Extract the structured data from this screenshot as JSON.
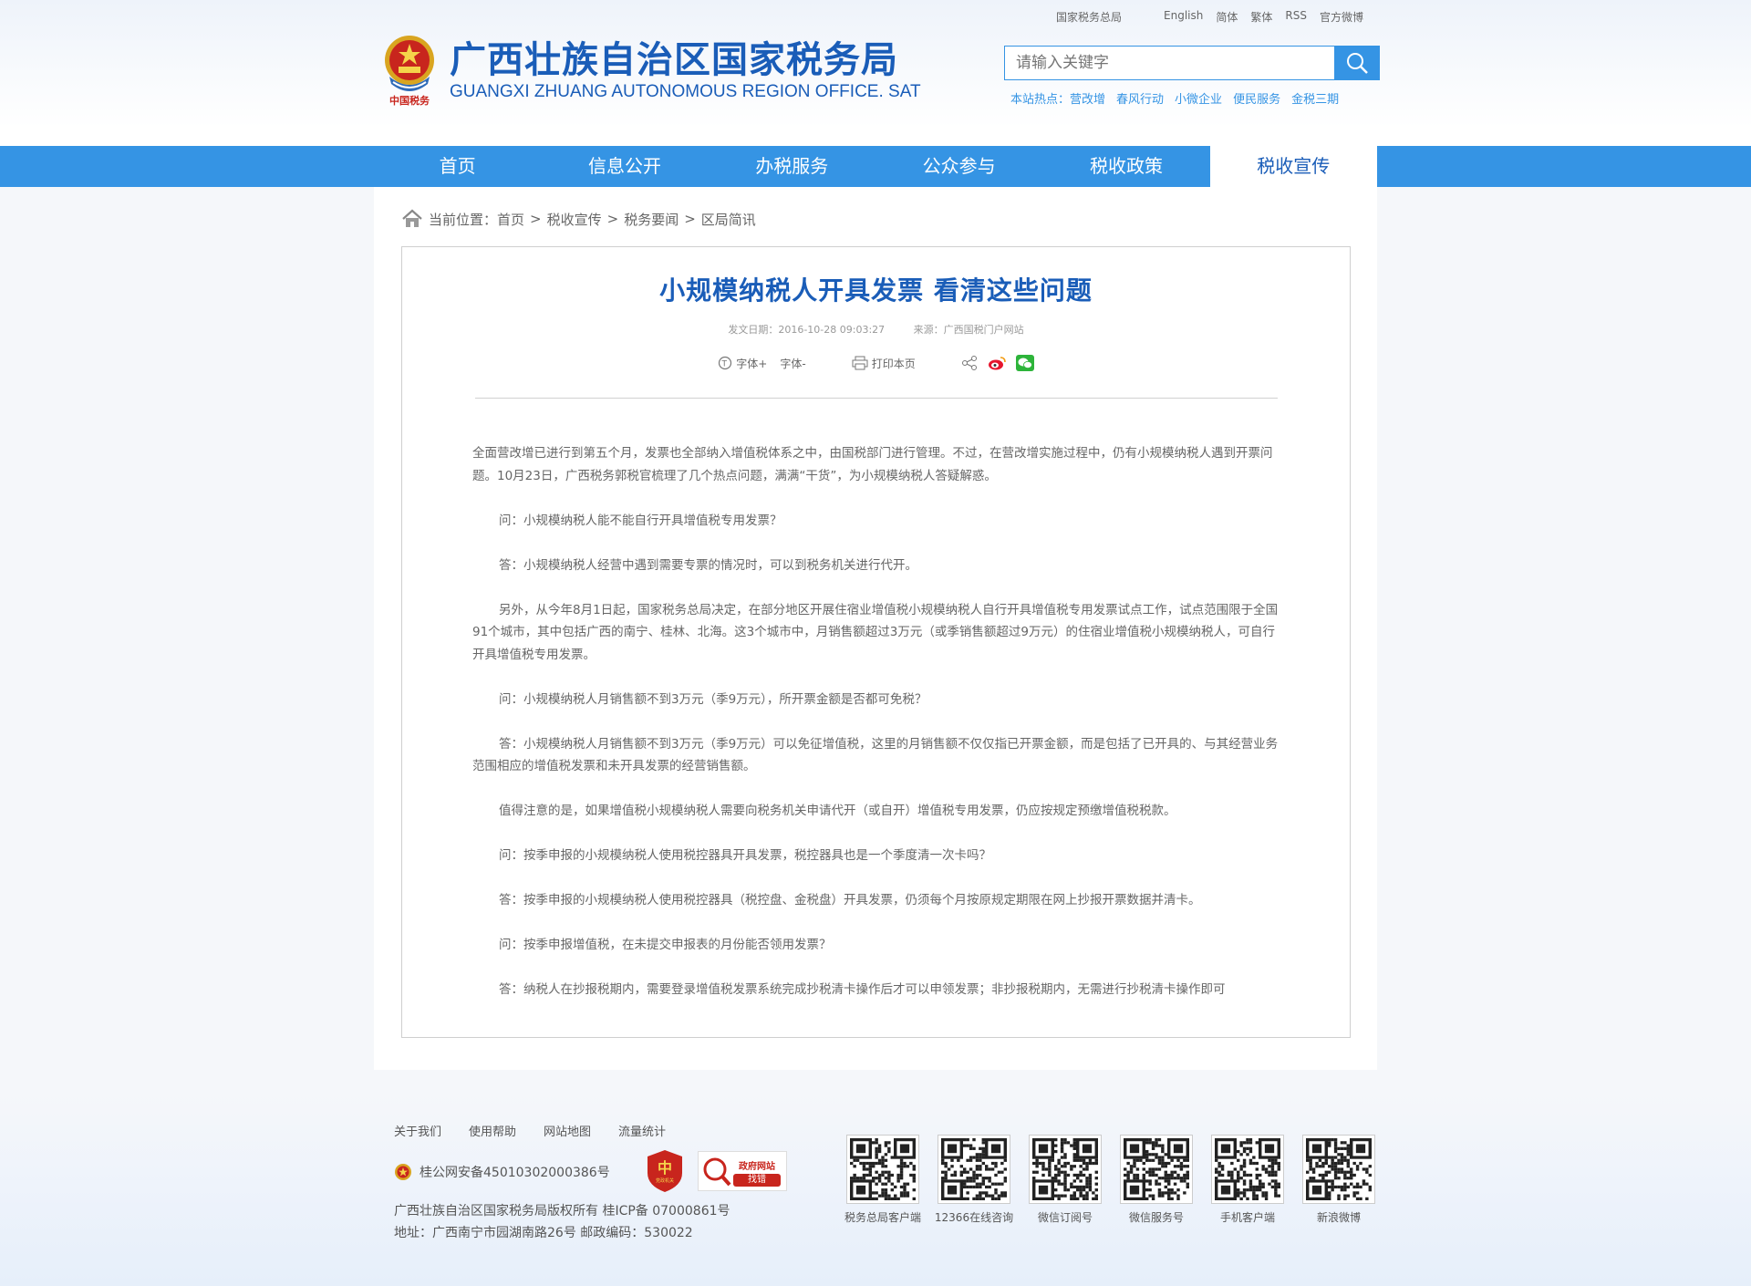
{
  "top_links": [
    "国家税务总局",
    "English",
    "简体",
    "繁体",
    "RSS",
    "官方微博"
  ],
  "logo": {
    "cn": "广西壮族自治区国家税务局",
    "en": "GUANGXI ZHUANG AUTONOMOUS REGION OFFICE. SAT",
    "seal_text": "中国税务"
  },
  "search": {
    "placeholder": "请输入关键字"
  },
  "hot": {
    "label": "本站热点：",
    "items": [
      "营改增",
      "春风行动",
      "小微企业",
      "便民服务",
      "金税三期"
    ]
  },
  "nav": {
    "items": [
      "首页",
      "信息公开",
      "办税服务",
      "公众参与",
      "税收政策",
      "税收宣传"
    ],
    "active": 5
  },
  "breadcrumb": {
    "label": "当前位置：",
    "items": [
      "首页",
      "税收宣传",
      "税务要闻",
      "区局简讯"
    ]
  },
  "article": {
    "title": "小规模纳税人开具发票 看清这些问题",
    "date": "发文日期：2016-10-28 09:03:27",
    "source": "来源：广西国税门户网站",
    "tools": {
      "font_plus": "字体+",
      "font_minus": "字体-",
      "print": "打印本页"
    },
    "paragraphs": [
      "全面营改增已进行到第五个月，发票也全部纳入增值税体系之中，由国税部门进行管理。不过，在营改增实施过程中，仍有小规模纳税人遇到开票问题。10月23日，广西税务郭税官梳理了几个热点问题，满满“干货”，为小规模纳税人答疑解惑。",
      "问：小规模纳税人能不能自行开具增值税专用发票？",
      "答：小规模纳税人经营中遇到需要专票的情况时，可以到税务机关进行代开。",
      "另外，从今年8月1日起，国家税务总局决定，在部分地区开展住宿业增值税小规模纳税人自行开具增值税专用发票试点工作，试点范围限于全国91个城市，其中包括广西的南宁、桂林、北海。这3个城市中，月销售额超过3万元（或季销售额超过9万元）的住宿业增值税小规模纳税人，可自行开具增值税专用发票。",
      "问：小规模纳税人月销售额不到3万元（季9万元），所开票金额是否都可免税？",
      "答：小规模纳税人月销售额不到3万元（季9万元）可以免征增值税，这里的月销售额不仅仅指已开票金额，而是包括了已开具的、与其经营业务范围相应的增值税发票和未开具发票的经营销售额。",
      "值得注意的是，如果增值税小规模纳税人需要向税务机关申请代开（或自开）增值税专用发票，仍应按规定预缴增值税税款。",
      "问：按季申报的小规模纳税人使用税控器具开具发票，税控器具也是一个季度清一次卡吗？",
      "答：按季申报的小规模纳税人使用税控器具（税控盘、金税盘）开具发票，仍须每个月按原规定期限在网上抄报开票数据并清卡。",
      "问：按季申报增值税，在未提交申报表的月份能否领用发票？",
      "答：纳税人在抄报税期内，需要登录增值税发票系统完成抄税清卡操作后才可以申领发票；非抄报税期内，无需进行抄税清卡操作即可"
    ]
  },
  "footer": {
    "links": [
      "关于我们",
      "使用帮助",
      "网站地图",
      "流量统计"
    ],
    "police": "桂公网安备45010302000386号",
    "badge_text": "党政机关",
    "badge2_line1": "政府网站",
    "badge2_line2": "找错",
    "copyright": "广西壮族自治区国家税务局版权所有 桂ICP备 07000861号",
    "address": "地址：广西南宁市园湖南路26号 邮政编码：530022",
    "qrs": [
      "税务总局客户端",
      "12366在线咨询",
      "微信订阅号",
      "微信服务号",
      "手机客户端",
      "新浪微博"
    ]
  },
  "colors": {
    "primary": "#3594e4",
    "title": "#1a5db8"
  }
}
